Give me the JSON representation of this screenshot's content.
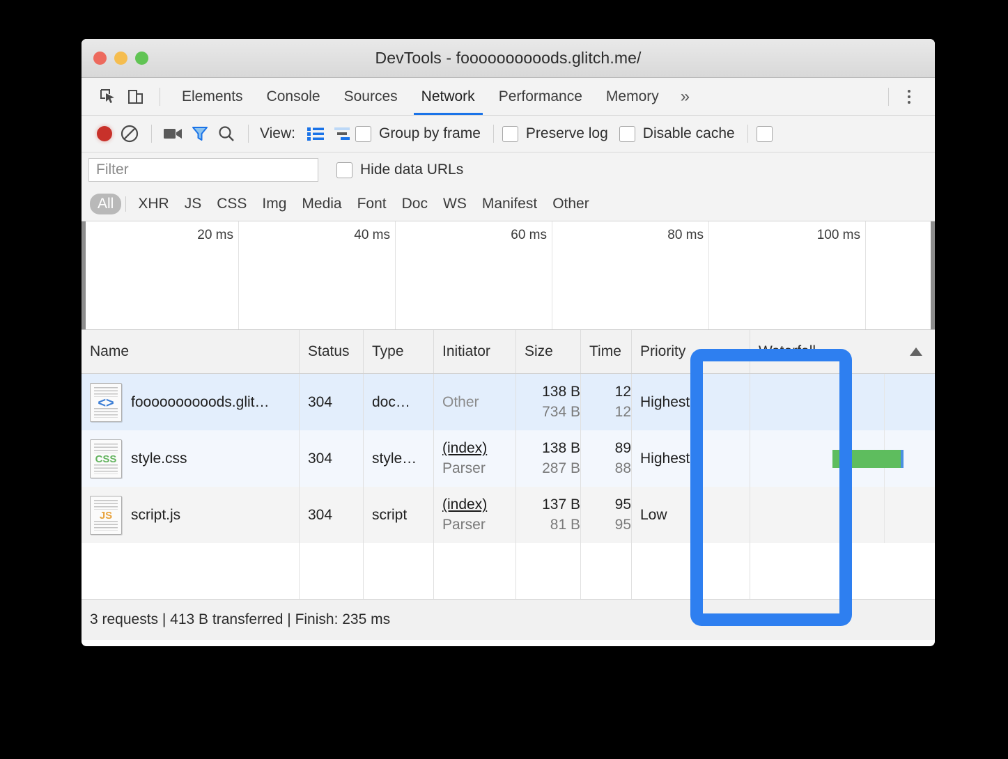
{
  "window": {
    "title": "DevTools - foooooooooods.glitch.me/",
    "traffic_lights": [
      "close-red",
      "minimize-yellow",
      "zoom-green"
    ]
  },
  "tabbar": {
    "inspect_icon": "inspect-element-icon",
    "device_icon": "device-toolbar-icon",
    "tabs": [
      {
        "label": "Elements",
        "active": false
      },
      {
        "label": "Console",
        "active": false
      },
      {
        "label": "Sources",
        "active": false
      },
      {
        "label": "Network",
        "active": true
      },
      {
        "label": "Performance",
        "active": false
      },
      {
        "label": "Memory",
        "active": false
      }
    ],
    "overflow_label": "»",
    "more_menu_icon": "vertical-dots-icon"
  },
  "toolbar": {
    "record_icon": "record-button-icon",
    "clear_icon": "clear-icon",
    "camera_icon": "capture-screenshots-icon",
    "filter_icon": "filter-funnel-icon",
    "search_icon": "search-icon",
    "view_label": "View:",
    "list_view_icon": "list-view-icon",
    "waterfall_view_icon": "waterfall-view-icon",
    "checkboxes": [
      {
        "label": "Group by frame",
        "checked": false
      },
      {
        "label": "Preserve log",
        "checked": false
      },
      {
        "label": "Disable cache",
        "checked": false
      },
      {
        "label": "",
        "checked": false
      }
    ]
  },
  "filter_row": {
    "input_value": "",
    "input_placeholder": "Filter",
    "hide_data_urls_label": "Hide data URLs",
    "hide_data_urls_checked": false
  },
  "type_chips": {
    "selected": "All",
    "items": [
      "All",
      "XHR",
      "JS",
      "CSS",
      "Img",
      "Media",
      "Font",
      "Doc",
      "WS",
      "Manifest",
      "Other"
    ]
  },
  "overview": {
    "ticks": [
      "20 ms",
      "40 ms",
      "60 ms",
      "80 ms",
      "100 ms"
    ]
  },
  "table": {
    "columns": [
      "Name",
      "Status",
      "Type",
      "Initiator",
      "Size",
      "Time",
      "Priority",
      "Waterfall"
    ],
    "sort_indicator": "sort-ascending-arrow",
    "rows": [
      {
        "icon": "document-file-icon",
        "icon_glyph": "<>",
        "name": "foooooooooods.glit…",
        "status": "304",
        "type": "doc…",
        "initiator": "Other",
        "initiator_sub": "",
        "size": "138 B",
        "size_sub": "734 B",
        "time": "12",
        "time_sub": "12",
        "priority": "Highest"
      },
      {
        "icon": "css-file-icon",
        "icon_glyph": "CSS",
        "name": "style.css",
        "status": "304",
        "type": "style…",
        "initiator": "(index)",
        "initiator_sub": "Parser",
        "size": "138 B",
        "size_sub": "287 B",
        "time": "89",
        "time_sub": "88",
        "priority": "Highest"
      },
      {
        "icon": "js-file-icon",
        "icon_glyph": "JS",
        "name": "script.js",
        "status": "304",
        "type": "script",
        "initiator": "(index)",
        "initiator_sub": "Parser",
        "size": "137 B",
        "size_sub": "81 B",
        "time": "95",
        "time_sub": "95",
        "priority": "Low"
      }
    ]
  },
  "statusbar": {
    "text": "3 requests | 413 B transferred | Finish: 235 ms"
  },
  "annotation": {
    "highlight_color": "#2e7ff0",
    "highlights_column": "Priority"
  },
  "colors": {
    "accent_blue": "#1a73e8",
    "waterfall_green": "#5ebd5e",
    "waterfall_blue": "#4a90e2",
    "selected_row": "#e3eefc"
  }
}
